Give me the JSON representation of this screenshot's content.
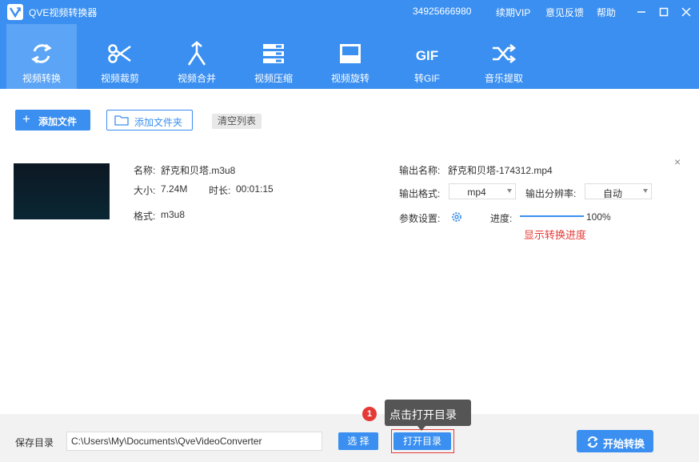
{
  "app": {
    "title": "QVE视频转换器"
  },
  "titlebar": {
    "phone": "34925666980",
    "vip": "续期VIP",
    "feedback": "意见反馈",
    "help": "帮助"
  },
  "toolbar": {
    "tools": [
      {
        "label": "视频转换",
        "icon": "convert-icon",
        "active": true
      },
      {
        "label": "视频裁剪",
        "icon": "scissors-icon",
        "active": false
      },
      {
        "label": "视频合并",
        "icon": "merge-icon",
        "active": false
      },
      {
        "label": "视频压缩",
        "icon": "compress-icon",
        "active": false
      },
      {
        "label": "视频旋转",
        "icon": "rotate-icon",
        "active": false
      },
      {
        "label": "转GIF",
        "icon": "gif-icon",
        "active": false
      },
      {
        "label": "音乐提取",
        "icon": "shuffle-icon",
        "active": false
      }
    ],
    "gif_glyph": "GIF"
  },
  "actions": {
    "add_file": "添加文件",
    "add_folder": "添加文件夹",
    "clear_list": "清空列表"
  },
  "file": {
    "name_label": "名称:",
    "name": "舒克和贝塔.m3u8",
    "size_label": "大小:",
    "size": "7.24M",
    "duration_label": "时长:",
    "duration": "00:01:15",
    "format_label": "格式:",
    "format": "m3u8",
    "output_name_label": "输出名称:",
    "output_name": "舒克和贝塔-174312.mp4",
    "output_format_label": "输出格式:",
    "output_format": "mp4",
    "output_resolution_label": "输出分辨率:",
    "output_resolution": "自动",
    "params_label": "参数设置:",
    "progress_label": "进度:",
    "progress_value": 1.0,
    "progress_text": "100%",
    "progress_note": "显示转换进度"
  },
  "bottom": {
    "save_dir_label": "保存目录",
    "save_path": "C:\\Users\\My\\Documents\\QveVideoConverter",
    "select_button": "选 择",
    "open_dir_button": "打开目录",
    "start_button": "开始转换"
  },
  "tooltip": {
    "badge": "1",
    "text": "点击打开目录"
  },
  "colors": {
    "accent": "#3a8ff0",
    "highlight": "#e53935"
  }
}
